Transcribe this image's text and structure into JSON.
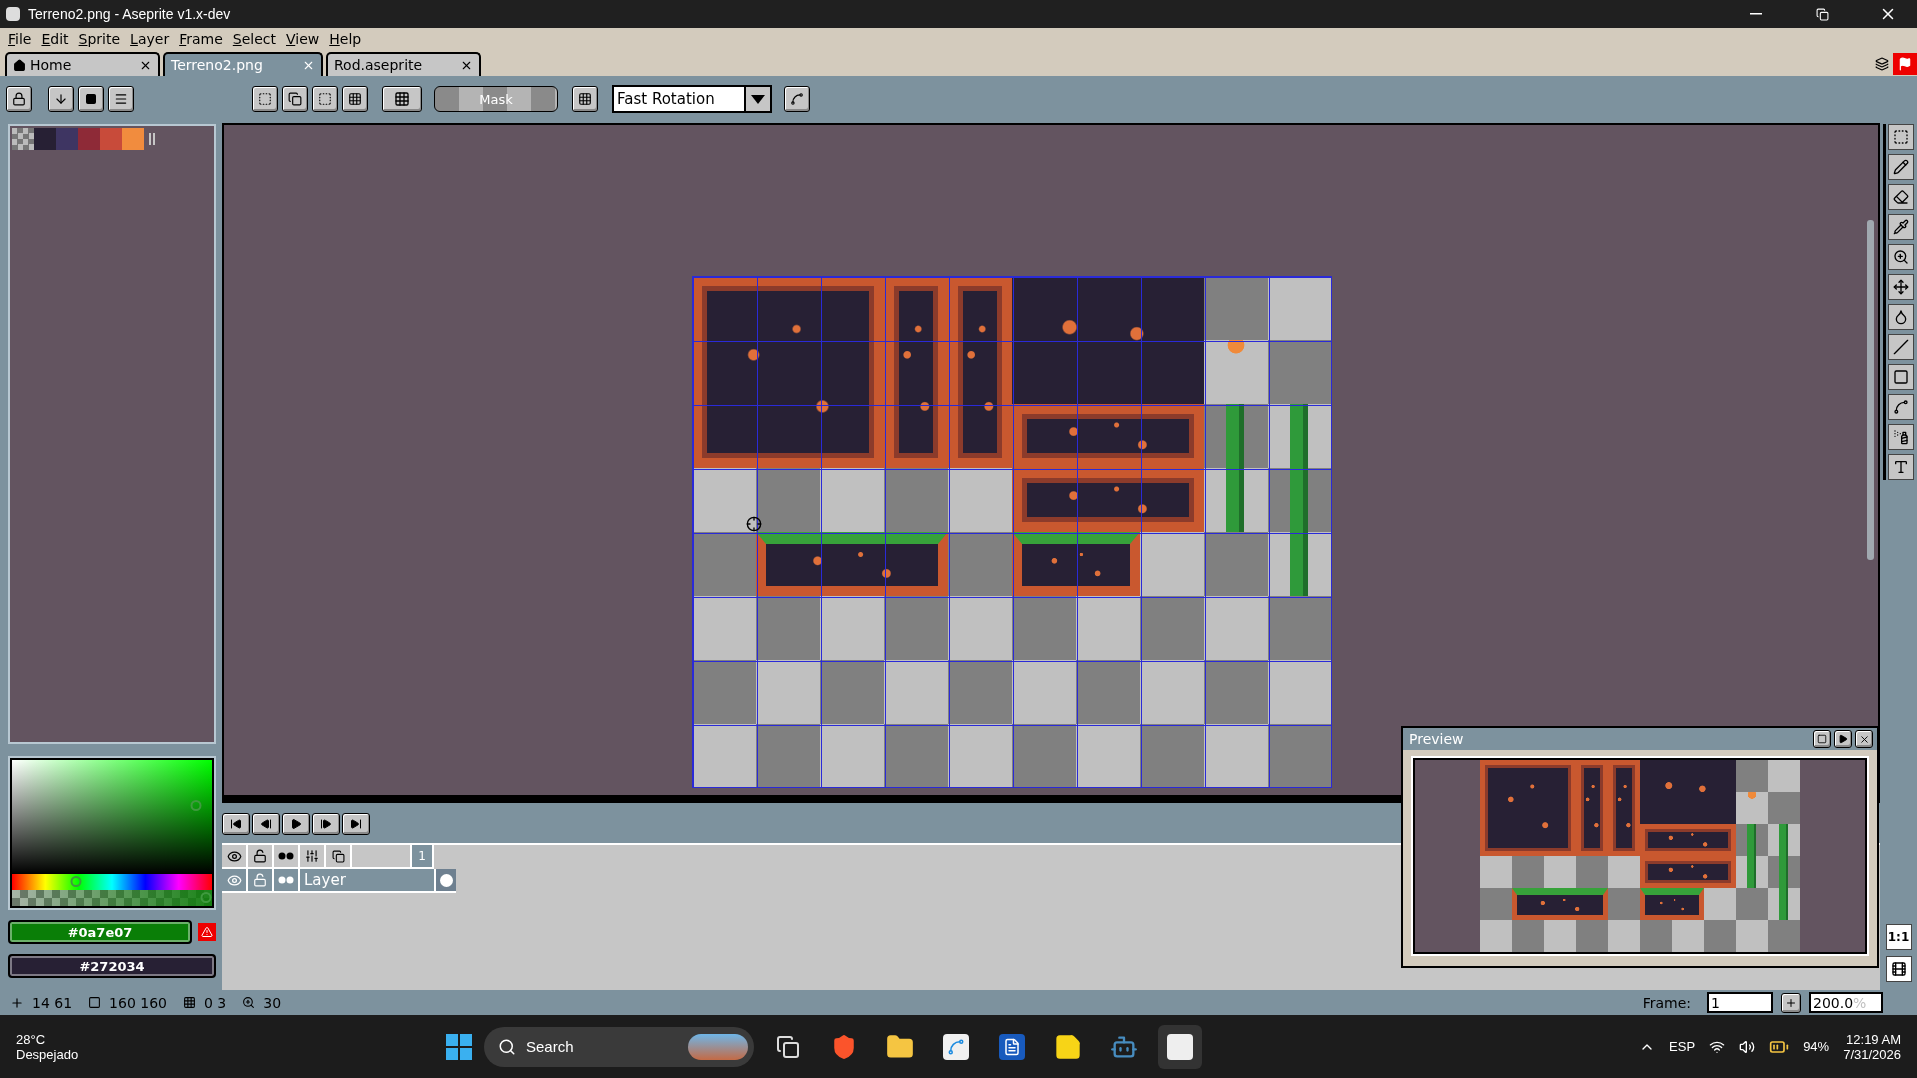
{
  "window": {
    "title": "Terreno2.png - Aseprite v1.x-dev"
  },
  "menu": [
    "File",
    "Edit",
    "Sprite",
    "Layer",
    "Frame",
    "Select",
    "View",
    "Help"
  ],
  "tabs": [
    {
      "label": "Home",
      "kind": "home",
      "selected": false
    },
    {
      "label": "Terreno2.png",
      "kind": "file",
      "selected": true
    },
    {
      "label": "Rod.aseprite",
      "kind": "file",
      "selected": false
    }
  ],
  "toolbar": {
    "mask_button": "Mask",
    "rotation_algorithm": "Fast Rotation"
  },
  "palette": [
    {
      "kind": "transparent"
    },
    {
      "kind": "swatch",
      "color": "#272034"
    },
    {
      "kind": "swatch",
      "color": "#3e3562"
    },
    {
      "kind": "swatch",
      "color": "#8e2a37"
    },
    {
      "kind": "swatch",
      "color": "#c84b3a"
    },
    {
      "kind": "swatch",
      "color": "#f18c3e"
    }
  ],
  "color_picker": {
    "hue": {
      "level": 0.32
    },
    "alpha": {
      "level": 0.99
    },
    "foreground": {
      "label": "#0a7e07",
      "color": "#0a7e07"
    },
    "background": {
      "label": "#272034",
      "color": "#272034"
    }
  },
  "timeline": {
    "frames": [
      {
        "label": "1",
        "selected": true
      }
    ],
    "layers": [
      {
        "name": "Layer",
        "selected": true
      }
    ]
  },
  "preview": {
    "title": "Preview"
  },
  "tool_buttons": {
    "actual_size": "1:1"
  },
  "status_bar": {
    "cursor": "14 61",
    "size": "160 160",
    "grid": "0 3",
    "zoom_level": "30",
    "frame_label": "Frame:",
    "frame_value": "1",
    "zoom_value": "200.0",
    "zoom_unit": "%"
  },
  "taskbar": {
    "temperature": "28°C",
    "weather": "Despejado",
    "search": "Search",
    "language": "ESP",
    "battery": "94%",
    "time": "12:19 AM",
    "date": "7/31/2026"
  }
}
